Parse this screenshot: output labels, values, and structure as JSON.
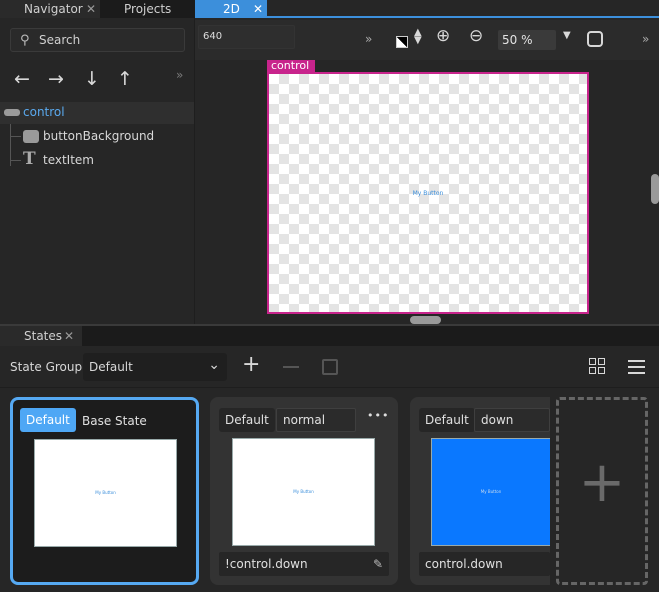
{
  "tabs": {
    "navigator": "Navigator",
    "projects": "Projects",
    "editor2d": "2D",
    "close_glyph": "✕"
  },
  "navigator": {
    "search_placeholder": "Search",
    "arrows": [
      "←",
      "→",
      "↓",
      "↑"
    ],
    "more_glyph": "»",
    "tree": [
      {
        "label": "control",
        "icon": "rectangle-icon",
        "selected": true
      },
      {
        "label": "buttonBackground",
        "icon": "rectangle-icon"
      },
      {
        "label": "textItem",
        "icon": "text-t-icon"
      }
    ]
  },
  "toolbar": {
    "width_value": "640",
    "more_glyph": "»",
    "zoom_value": "50 %",
    "icons": [
      "checker-bg-icon",
      "spin-updown-icon",
      "zoom-in-icon",
      "zoom-out-icon",
      "dropdown-icon",
      "fit-screen-icon"
    ]
  },
  "canvas": {
    "root_label": "control",
    "text": "My Button"
  },
  "states_panel": {
    "tab_label": "States",
    "state_group_label": "State Group",
    "state_group_value": "Default",
    "toolbar_icons": [
      "add-state-icon",
      "remove-state-icon",
      "edit-state-icon",
      "grid-view-icon",
      "list-view-icon"
    ],
    "cards": [
      {
        "group": "Default",
        "name": "Base State",
        "selected": true,
        "when": "",
        "thumb_text": "My Button"
      },
      {
        "group": "Default",
        "name": "normal",
        "more": "•••",
        "when": "!control.down",
        "thumb_text": "My Button"
      },
      {
        "group": "Default",
        "name": "down",
        "when": "control.down",
        "thumb_text": "My Button"
      }
    ],
    "add_glyph": "+"
  },
  "colors": {
    "accent": "#3c8fdb",
    "selection": "#c8248c",
    "state_down_fill": "#0a78ff"
  }
}
